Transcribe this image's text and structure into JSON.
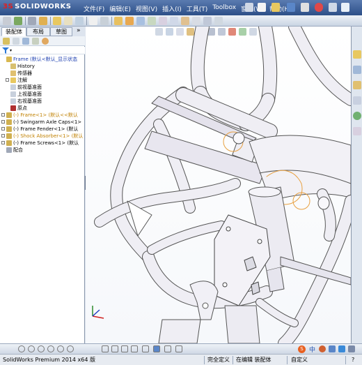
{
  "app": {
    "logo_prefix": "3S",
    "logo_text": "SOLIDWORKS"
  },
  "menu": {
    "items": [
      "文件(F)",
      "编辑(E)",
      "视图(V)",
      "插入(I)",
      "工具(T)",
      "Toolbox",
      "窗口(W)",
      "帮助(H)"
    ]
  },
  "left_panel": {
    "tabs": [
      "装配体",
      "布局",
      "草图"
    ],
    "expand_label": "»",
    "filter_icon": "funnel-icon",
    "tree": [
      {
        "label": "Frame  (默认<默认_显示状态",
        "style": "root",
        "icon": "assembly-icon",
        "indent": 0,
        "expand": ""
      },
      {
        "label": "History",
        "style": "normal",
        "icon": "history-icon",
        "indent": 1,
        "expand": ""
      },
      {
        "label": "传感器",
        "style": "normal",
        "icon": "sensor-icon",
        "indent": 1,
        "expand": ""
      },
      {
        "label": "注解",
        "style": "normal",
        "icon": "annotation-icon",
        "indent": 1,
        "expand": "+"
      },
      {
        "label": "前视基准面",
        "style": "normal",
        "icon": "plane-icon",
        "indent": 1,
        "expand": ""
      },
      {
        "label": "上视基准面",
        "style": "normal",
        "icon": "plane-icon",
        "indent": 1,
        "expand": ""
      },
      {
        "label": "右视基准面",
        "style": "normal",
        "icon": "plane-icon",
        "indent": 1,
        "expand": ""
      },
      {
        "label": "原点",
        "style": "normal",
        "icon": "origin-icon",
        "indent": 1,
        "expand": ""
      },
      {
        "label": "(-) Frame<1> (默认<<默认",
        "style": "orange",
        "icon": "part-icon",
        "indent": 0,
        "expand": "+"
      },
      {
        "label": "(-) Swingarm Axle Caps<1>",
        "style": "normal",
        "icon": "part-icon",
        "indent": 0,
        "expand": "+"
      },
      {
        "label": "(-) Frame Fender<1> (默认",
        "style": "normal",
        "icon": "part-icon",
        "indent": 0,
        "expand": "+"
      },
      {
        "label": "(-) Shock Absorber<1> (默认",
        "style": "orange",
        "icon": "part-icon",
        "indent": 0,
        "expand": "+"
      },
      {
        "label": "(-) Frame Screws<1> (默认",
        "style": "normal",
        "icon": "part-icon",
        "indent": 0,
        "expand": "+"
      },
      {
        "label": "配合",
        "style": "normal",
        "icon": "mates-icon",
        "indent": 0,
        "expand": ""
      }
    ]
  },
  "status": {
    "product": "SolidWorks Premium 2014 x64 版",
    "state": "完全定义",
    "mode": "在编辑 装配体",
    "units": "自定义",
    "help": "?"
  },
  "ime": {
    "label": "中"
  },
  "colors": {
    "menubar": "#2d4f88",
    "model_outline": "#555555",
    "model_fill": "#efeef4",
    "selection_highlight": "#e8a040"
  }
}
